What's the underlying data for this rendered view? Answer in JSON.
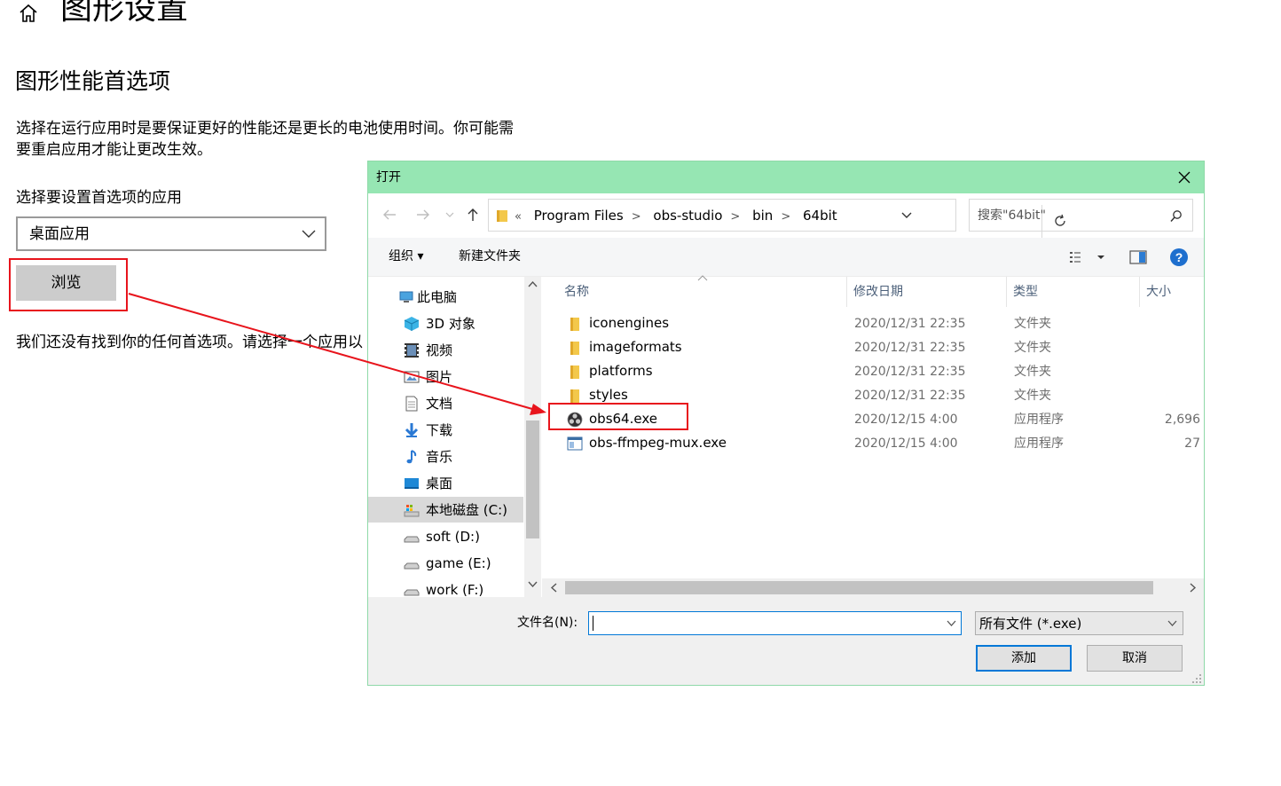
{
  "settings": {
    "page_title": "图形设置",
    "section_title": "图形性能首选项",
    "description": "选择在运行应用时是要保证更好的性能还是更长的电池使用时间。你可能需要重启应用才能让更改生效。",
    "app_select_label": "选择要设置首选项的应用",
    "app_type_value": "桌面应用",
    "browse_button": "浏览",
    "no_prefs_text": "我们还没有找到你的任何首选项。请选择一个应用以"
  },
  "dialog": {
    "title": "打开",
    "address": {
      "overflow": "«",
      "crumbs": [
        "Program Files",
        "obs-studio",
        "bin",
        "64bit"
      ]
    },
    "search_placeholder": "搜索\"64bit\"",
    "toolbar": {
      "organize": "组织 ▾",
      "new_folder": "新建文件夹"
    },
    "nav_items": [
      {
        "label": "此电脑",
        "icon": "computer-icon"
      },
      {
        "label": "3D 对象",
        "icon": "3d-objects-icon"
      },
      {
        "label": "视频",
        "icon": "video-icon"
      },
      {
        "label": "图片",
        "icon": "pictures-icon"
      },
      {
        "label": "文档",
        "icon": "documents-icon"
      },
      {
        "label": "下载",
        "icon": "downloads-icon"
      },
      {
        "label": "音乐",
        "icon": "music-icon"
      },
      {
        "label": "桌面",
        "icon": "desktop-icon"
      },
      {
        "label": "本地磁盘 (C:)",
        "icon": "local-disk-icon",
        "selected": true
      },
      {
        "label": "soft (D:)",
        "icon": "drive-icon"
      },
      {
        "label": "game (E:)",
        "icon": "drive-icon"
      },
      {
        "label": "work (F:)",
        "icon": "drive-icon"
      }
    ],
    "columns": {
      "name": "名称",
      "date": "修改日期",
      "type": "类型",
      "size": "大小"
    },
    "files": [
      {
        "name": "iconengines",
        "date": "2020/12/31 22:35",
        "type": "文件夹",
        "size": "",
        "icon": "folder-icon"
      },
      {
        "name": "imageformats",
        "date": "2020/12/31 22:35",
        "type": "文件夹",
        "size": "",
        "icon": "folder-icon"
      },
      {
        "name": "platforms",
        "date": "2020/12/31 22:35",
        "type": "文件夹",
        "size": "",
        "icon": "folder-icon"
      },
      {
        "name": "styles",
        "date": "2020/12/31 22:35",
        "type": "文件夹",
        "size": "",
        "icon": "folder-icon"
      },
      {
        "name": "obs64.exe",
        "date": "2020/12/15 4:00",
        "type": "应用程序",
        "size": "2,696",
        "icon": "obs-app-icon"
      },
      {
        "name": "obs-ffmpeg-mux.exe",
        "date": "2020/12/15 4:00",
        "type": "应用程序",
        "size": "27",
        "icon": "exe-app-icon"
      }
    ],
    "filename_label": "文件名(N):",
    "filename_value": "",
    "filter_value": "所有文件 (*.exe)",
    "add_button": "添加",
    "cancel_button": "取消"
  },
  "colors": {
    "titlebar": "#96e6b3",
    "annotation_red": "#e8141c",
    "accent_blue": "#0078d7"
  }
}
